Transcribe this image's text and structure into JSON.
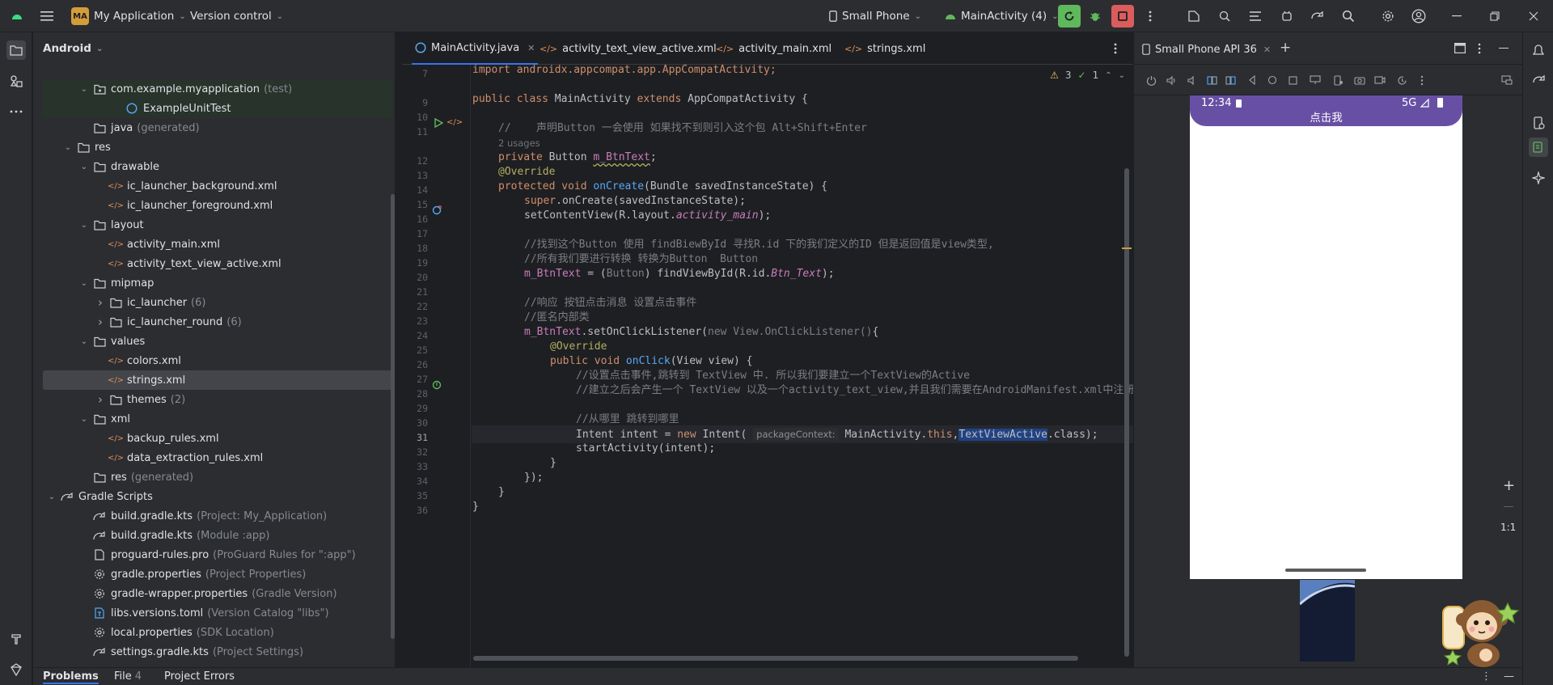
{
  "topbar": {
    "project_badge": "MA",
    "project_name": "My Application",
    "vcs": "Version control",
    "device": "Small Phone",
    "run_config": "MainActivity (4)"
  },
  "project_panel": {
    "view": "Android",
    "tree": [
      {
        "label": "com.example.myapplication",
        "hint": "(test)",
        "indent": 2,
        "arrow": "down",
        "icon": "package-icon",
        "style": "test"
      },
      {
        "label": "ExampleUnitTest",
        "hint": "",
        "indent": 4,
        "arrow": "",
        "icon": "class-icon",
        "style": "test"
      },
      {
        "label": "java",
        "hint": "(generated)",
        "indent": 2,
        "arrow": "",
        "icon": "folder-icon",
        "style": ""
      },
      {
        "label": "res",
        "hint": "",
        "indent": 1,
        "arrow": "down",
        "icon": "folder-icon",
        "style": ""
      },
      {
        "label": "drawable",
        "hint": "",
        "indent": 2,
        "arrow": "down",
        "icon": "folder-icon",
        "style": ""
      },
      {
        "label": "ic_launcher_background.xml",
        "hint": "",
        "indent": 3,
        "arrow": "",
        "icon": "xml-icon",
        "style": ""
      },
      {
        "label": "ic_launcher_foreground.xml",
        "hint": "",
        "indent": 3,
        "arrow": "",
        "icon": "xml-icon",
        "style": ""
      },
      {
        "label": "layout",
        "hint": "",
        "indent": 2,
        "arrow": "down",
        "icon": "folder-icon",
        "style": ""
      },
      {
        "label": "activity_main.xml",
        "hint": "",
        "indent": 3,
        "arrow": "",
        "icon": "xml-icon",
        "style": ""
      },
      {
        "label": "activity_text_view_active.xml",
        "hint": "",
        "indent": 3,
        "arrow": "",
        "icon": "xml-icon",
        "style": ""
      },
      {
        "label": "mipmap",
        "hint": "",
        "indent": 2,
        "arrow": "down",
        "icon": "folder-icon",
        "style": ""
      },
      {
        "label": "ic_launcher",
        "hint": "(6)",
        "indent": 3,
        "arrow": "right",
        "icon": "folder-icon",
        "style": ""
      },
      {
        "label": "ic_launcher_round",
        "hint": "(6)",
        "indent": 3,
        "arrow": "right",
        "icon": "folder-icon",
        "style": ""
      },
      {
        "label": "values",
        "hint": "",
        "indent": 2,
        "arrow": "down",
        "icon": "folder-icon",
        "style": ""
      },
      {
        "label": "colors.xml",
        "hint": "",
        "indent": 3,
        "arrow": "",
        "icon": "xml-icon",
        "style": ""
      },
      {
        "label": "strings.xml",
        "hint": "",
        "indent": 3,
        "arrow": "",
        "icon": "xml-icon",
        "style": "sel"
      },
      {
        "label": "themes",
        "hint": "(2)",
        "indent": 3,
        "arrow": "right",
        "icon": "folder-icon",
        "style": ""
      },
      {
        "label": "xml",
        "hint": "",
        "indent": 2,
        "arrow": "down",
        "icon": "folder-icon",
        "style": ""
      },
      {
        "label": "backup_rules.xml",
        "hint": "",
        "indent": 3,
        "arrow": "",
        "icon": "xml-icon",
        "style": ""
      },
      {
        "label": "data_extraction_rules.xml",
        "hint": "",
        "indent": 3,
        "arrow": "",
        "icon": "xml-icon",
        "style": ""
      },
      {
        "label": "res",
        "hint": "(generated)",
        "indent": 2,
        "arrow": "",
        "icon": "folder-icon",
        "style": ""
      },
      {
        "label": "Gradle Scripts",
        "hint": "",
        "indent": 0,
        "arrow": "down",
        "icon": "gradle-icon",
        "style": ""
      },
      {
        "label": "build.gradle.kts",
        "hint": "(Project: My_Application)",
        "indent": 2,
        "arrow": "",
        "icon": "gradle-file-icon",
        "style": ""
      },
      {
        "label": "build.gradle.kts",
        "hint": "(Module :app)",
        "indent": 2,
        "arrow": "",
        "icon": "gradle-file-icon",
        "style": ""
      },
      {
        "label": "proguard-rules.pro",
        "hint": "(ProGuard Rules for \":app\")",
        "indent": 2,
        "arrow": "",
        "icon": "file-icon",
        "style": ""
      },
      {
        "label": "gradle.properties",
        "hint": "(Project Properties)",
        "indent": 2,
        "arrow": "",
        "icon": "settings-file-icon",
        "style": ""
      },
      {
        "label": "gradle-wrapper.properties",
        "hint": "(Gradle Version)",
        "indent": 2,
        "arrow": "",
        "icon": "settings-file-icon",
        "style": ""
      },
      {
        "label": "libs.versions.toml",
        "hint": "(Version Catalog \"libs\")",
        "indent": 2,
        "arrow": "",
        "icon": "toml-icon",
        "style": ""
      },
      {
        "label": "local.properties",
        "hint": "(SDK Location)",
        "indent": 2,
        "arrow": "",
        "icon": "settings-file-icon",
        "style": ""
      },
      {
        "label": "settings.gradle.kts",
        "hint": "(Project Settings)",
        "indent": 2,
        "arrow": "",
        "icon": "gradle-file-icon",
        "style": ""
      }
    ]
  },
  "editor": {
    "tabs": [
      {
        "label": "MainActivity.java",
        "active": true
      },
      {
        "label": "activity_text_view_active.xml",
        "active": false
      },
      {
        "label": "activity_main.xml",
        "active": false
      },
      {
        "label": "strings.xml",
        "active": false
      }
    ],
    "inspections": {
      "warnings": "3",
      "weak": "1"
    },
    "line_numbers": [
      "7",
      "9",
      "10",
      "11",
      "12",
      "13",
      "14",
      "15",
      "16",
      "17",
      "18",
      "19",
      "20",
      "21",
      "22",
      "23",
      "24",
      "25",
      "26",
      "27",
      "28",
      "29",
      "30",
      "31",
      "32",
      "33",
      "34",
      "35",
      "36"
    ],
    "usages_hint": "2 usages",
    "code": {
      "l7": "import androidx.appcompat.app.AppCompatActivity;",
      "l9a": "public class ",
      "l9b": "MainActivity",
      "l9c": " extends ",
      "l9d": "AppCompatActivity {",
      "l11": "//    声明Button 一会使用 如果找不到则引入这个包 Alt+Shift+Enter",
      "l12a": "private ",
      "l12b": "Button ",
      "l12c": "m_BtnText",
      "l12d": ";",
      "l13": "@Override",
      "l14a": "protected void ",
      "l14b": "onCreate",
      "l14c": "(Bundle savedInstanceState) {",
      "l15a": "super",
      "l15b": ".onCreate(savedInstanceState);",
      "l16a": "setContentView(R.layout.",
      "l16b": "activity_main",
      "l16c": ");",
      "l18": "//找到这个Button 使用 findBiewById 寻找R.id 下的我们定义的ID 但是返回值是view类型,",
      "l19": "//所有我们要进行转换 转换为Button  Button",
      "l20a": "m_BtnText",
      "l20b": " = (",
      "l20c": "Button",
      "l20d": ") findViewById(R.id.",
      "l20e": "Btn_Text",
      "l20f": ");",
      "l22": "//响应 按钮点击消息 设置点击事件",
      "l23": "//匿名内部类",
      "l24a": "m_BtnText",
      "l24b": ".setOnClickListener(",
      "l24c": "new View.OnClickListener()",
      "l24d": "{",
      "l25": "@Override",
      "l26a": "public void ",
      "l26b": "onClick",
      "l26c": "(View view) {",
      "l27": "//设置点击事件,跳转到 TextView 中. 所以我们要建立一个TextView的Active",
      "l28": "//建立之后会产生一个 TextView 以及一个activity_text_view,并且我们需要在AndroidManifest.xml中注册",
      "l30": "//从哪里 跳转到哪里",
      "l31a": "Intent intent = ",
      "l31b": "new ",
      "l31c": "Intent( ",
      "l31d": "packageContext:",
      "l31e": " MainActivity.",
      "l31f": "this",
      "l31g": ",",
      "l31h": "TextViewActive",
      "l31i": ".class);",
      "l32": "startActivity(intent);",
      "l33": "}",
      "l34": "});",
      "l35": "}",
      "l36": "}"
    }
  },
  "emulator": {
    "tab_label": "Small Phone API 36",
    "status_time": "12:34",
    "status_net": "5G",
    "button_text": "点击我",
    "zoom_label": "1:1"
  },
  "bottom": {
    "problems": "Problems",
    "file": "File",
    "file_count": "4",
    "project_errors": "Project Errors"
  },
  "colors": {
    "accent": "#3574f0",
    "app_bar": "#6750a4",
    "run_green": "#5fb85c",
    "stop_red": "#db5c5c"
  }
}
